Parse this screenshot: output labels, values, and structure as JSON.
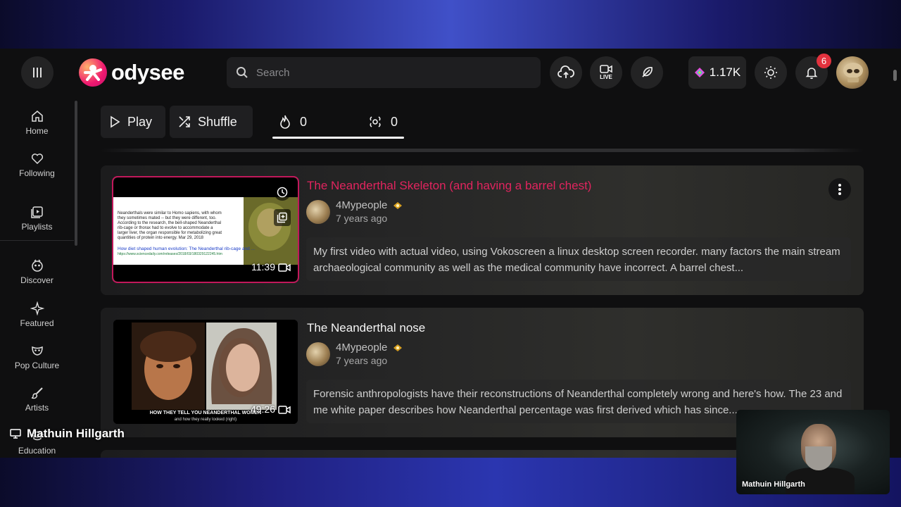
{
  "header": {
    "logo_text": "odysee",
    "search_placeholder": "Search",
    "live_label": "LIVE",
    "credits": "1.17K",
    "notifications_count": "6"
  },
  "sidebar": {
    "items": [
      {
        "label": "Home",
        "icon": "home-icon"
      },
      {
        "label": "Following",
        "icon": "heart-icon"
      },
      {
        "label": "Playlists",
        "icon": "playlist-icon"
      },
      {
        "label": "Discover",
        "icon": "discover-icon"
      },
      {
        "label": "Featured",
        "icon": "sparkle-icon"
      },
      {
        "label": "Pop Culture",
        "icon": "mask-icon"
      },
      {
        "label": "Artists",
        "icon": "brush-icon"
      },
      {
        "label": "Education",
        "icon": "education-icon"
      }
    ]
  },
  "toolbar": {
    "play_label": "Play",
    "shuffle_label": "Shuffle",
    "fire_count": "0",
    "slime_count": "0"
  },
  "videos": [
    {
      "title": "The Neanderthal Skeleton (and having a barrel chest)",
      "channel": "4Mypeople",
      "age": "7 years ago",
      "duration": "11:39",
      "description": "My first video with actual video, using Vokoscreen a linux desktop screen recorder. many factors the main stream archaeological community as well as the medical community have incorrect. A barrel chest...",
      "thumb_text": {
        "para": "Neanderthals were similar to Homo sapiens, with whom they sometimes mated -- but they were different, too. ... According to the research, the bell-shaped Neanderthal rib-cage or thorax had to evolve to accommodate a larger liver, the organ responsible for metabolizing great quantities of protein into energy.",
        "date": "Mar 29, 2018",
        "link": "How diet shaped human evolution: The Neanderthal rib-cage and ...",
        "url": "https://www.sciencedaily.com/releases/2018/03/180329122245.htm"
      }
    },
    {
      "title": "The Neanderthal nose",
      "channel": "4Mypeople",
      "age": "7 years ago",
      "duration": "49:26",
      "description": "Forensic anthropologists have their reconstructions of Neanderthal completely wrong and here's how. The 23 and me white paper describes how Neanderthal percentage was first derived which has since...",
      "thumb_text": {
        "caption": "HOW THEY TELL YOU NEANDERTHAL WOMEN",
        "subcaption": "and how they really looked (right)"
      }
    }
  ],
  "overlay": {
    "stream_name": "Mathuin Hillgarth",
    "webcam_label": "Mathuin Hillgarth"
  },
  "colors": {
    "accent": "#e0245e",
    "badge": "#e2323e",
    "background": "#0f0f10"
  }
}
